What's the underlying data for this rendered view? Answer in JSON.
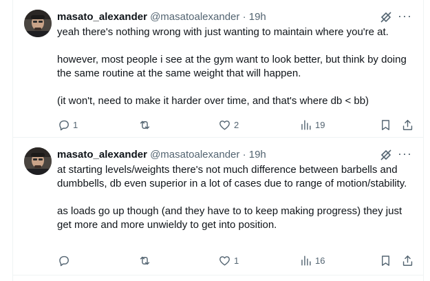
{
  "tweets": [
    {
      "author_name": "masato_alexander",
      "handle": "@masatoalexander",
      "separator": "·",
      "time": "19h",
      "paragraphs": [
        "yeah there's nothing wrong with just wanting to maintain where you're at.",
        "however, most people i see at the gym want to look better, but think by doing the same routine at the same weight that will happen.",
        "(it won't, need to make it harder over time, and that's where db < bb)"
      ],
      "replies": "1",
      "reposts": "",
      "likes": "2",
      "views": "19"
    },
    {
      "author_name": "masato_alexander",
      "handle": "@masatoalexander",
      "separator": "·",
      "time": "19h",
      "paragraphs": [
        "at starting levels/weights there's not much difference between barbells and dumbbells, db even superior in a lot of cases due to range of motion/stability.",
        "as loads go up though (and they have to to keep making progress) they just get more and more unwieldy to get into position."
      ],
      "replies": "",
      "reposts": "",
      "likes": "1",
      "views": "16"
    }
  ],
  "icons": {
    "grok": "grok-icon",
    "more": "more-icon",
    "reply": "reply-icon",
    "repost": "repost-icon",
    "like": "like-icon",
    "views": "views-icon",
    "bookmark": "bookmark-icon",
    "share": "share-icon"
  },
  "colors": {
    "text": "#0f1419",
    "secondary": "#536471",
    "border": "#eff3f4"
  }
}
